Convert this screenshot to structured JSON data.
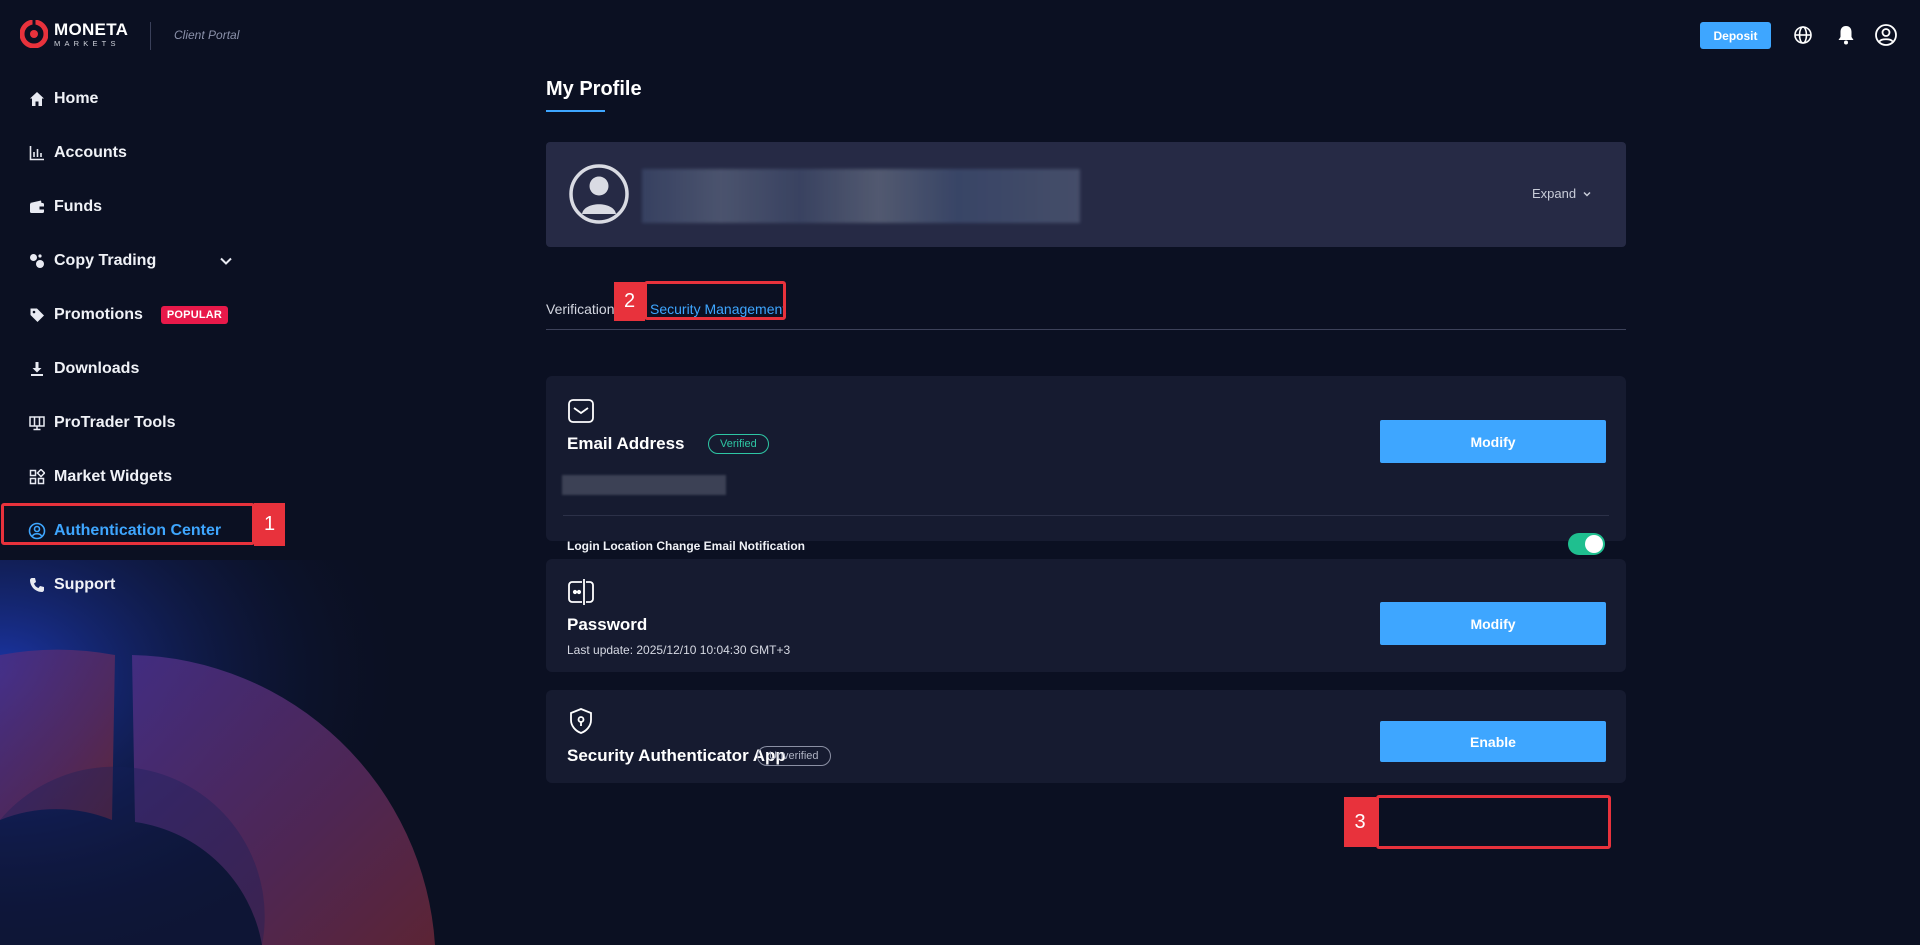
{
  "header": {
    "logo_line1": "MONETA",
    "logo_line2": "MARKETS",
    "portal_label": "Client Portal",
    "deposit_label": "Deposit",
    "icons": [
      "globe-icon",
      "bell-icon",
      "user-circle-icon"
    ]
  },
  "sidebar": {
    "items": [
      {
        "label": "Home",
        "icon": "home-icon"
      },
      {
        "label": "Accounts",
        "icon": "bar-chart-icon"
      },
      {
        "label": "Funds",
        "icon": "wallet-icon"
      },
      {
        "label": "Copy Trading",
        "icon": "copy-trading-icon"
      },
      {
        "label": "Promotions",
        "icon": "tag-icon",
        "badge": "POPULAR"
      },
      {
        "label": "Downloads",
        "icon": "download-icon"
      },
      {
        "label": "ProTrader Tools",
        "icon": "monitor-icon"
      },
      {
        "label": "Market Widgets",
        "icon": "widgets-icon"
      },
      {
        "label": "Authentication Center",
        "icon": "user-shield-icon",
        "active": true
      },
      {
        "label": "Support",
        "icon": "phone-icon"
      }
    ]
  },
  "annotations": {
    "step1": "1",
    "step2": "2",
    "step3": "3"
  },
  "main": {
    "title": "My Profile",
    "expand_label": "Expand",
    "tabs": [
      {
        "label": "Verification"
      },
      {
        "label": "Security Management",
        "active": true
      }
    ],
    "email_card": {
      "title": "Email Address",
      "status": "Verified",
      "button": "Modify",
      "toggle_label": "Login Location Change Email Notification",
      "toggle_on": true
    },
    "password_card": {
      "title": "Password",
      "last_update": "Last update: 2025/12/10 10:04:30 GMT+3",
      "button": "Modify"
    },
    "auth_card": {
      "title": "Security Authenticator App",
      "status": "Unverified",
      "button": "Enable"
    }
  },
  "colors": {
    "accent": "#3ea6ff",
    "background": "#0b1022",
    "card": "#161b30",
    "highlight": "#e8323c",
    "verified": "#2ec6a4",
    "badge": "#e8194a"
  }
}
